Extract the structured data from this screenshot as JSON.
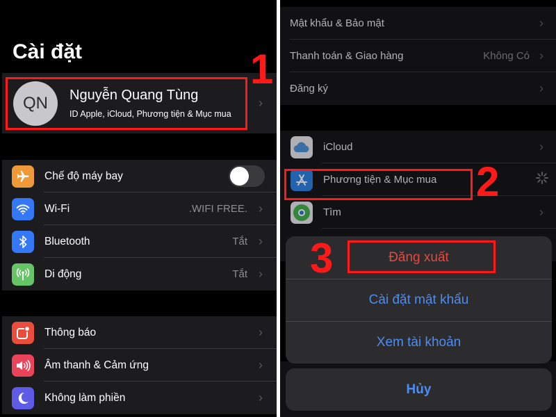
{
  "left": {
    "title": "Cài đặt",
    "profile": {
      "initials": "QN",
      "name": "Nguyễn Quang Tùng",
      "subtitle": "ID Apple, iCloud, Phương tiện & Mục mua"
    },
    "connectivity": [
      {
        "icon": "airplane-icon",
        "label": "Chế độ máy bay",
        "toggle": false,
        "color": "#f09a37"
      },
      {
        "icon": "wifi-icon",
        "label": "Wi-Fi",
        "value": ".WIFI FREE.",
        "color": "#3478f6"
      },
      {
        "icon": "bluetooth-icon",
        "label": "Bluetooth",
        "value": "Tắt",
        "color": "#3478f6"
      },
      {
        "icon": "cellular-icon",
        "label": "Di động",
        "value": "Tắt",
        "color": "#65c466"
      }
    ],
    "notifications": [
      {
        "icon": "notifications-icon",
        "label": "Thông báo",
        "color": "#eb4d3d"
      },
      {
        "icon": "sound-icon",
        "label": "Âm thanh & Cảm ứng",
        "color": "#eb445a"
      },
      {
        "icon": "moon-icon",
        "label": "Không làm phiền",
        "color": "#5e5ce6"
      }
    ]
  },
  "right": {
    "account_rows": [
      {
        "label": "Mật khẩu & Bảo mật"
      },
      {
        "label": "Thanh toán & Giao hàng",
        "value": "Không Có"
      },
      {
        "label": "Đăng ký"
      }
    ],
    "service_rows": [
      {
        "icon": "icloud-icon",
        "label": "iCloud"
      },
      {
        "icon": "app-store-icon",
        "label": "Phương tiện & Mục mua",
        "loading": true
      },
      {
        "icon": "find-my-icon",
        "label": "Tìm"
      }
    ],
    "action_sheet": {
      "buttons": [
        "Đăng xuất",
        "Cài đặt mật khẩu",
        "Xem tài khoản"
      ],
      "cancel": "Hủy"
    }
  },
  "annotations": [
    "1",
    "2",
    "3"
  ],
  "colors": {
    "annotation": "#ff1a1a",
    "link": "#4e8cf0",
    "destructive": "#e5483f"
  }
}
